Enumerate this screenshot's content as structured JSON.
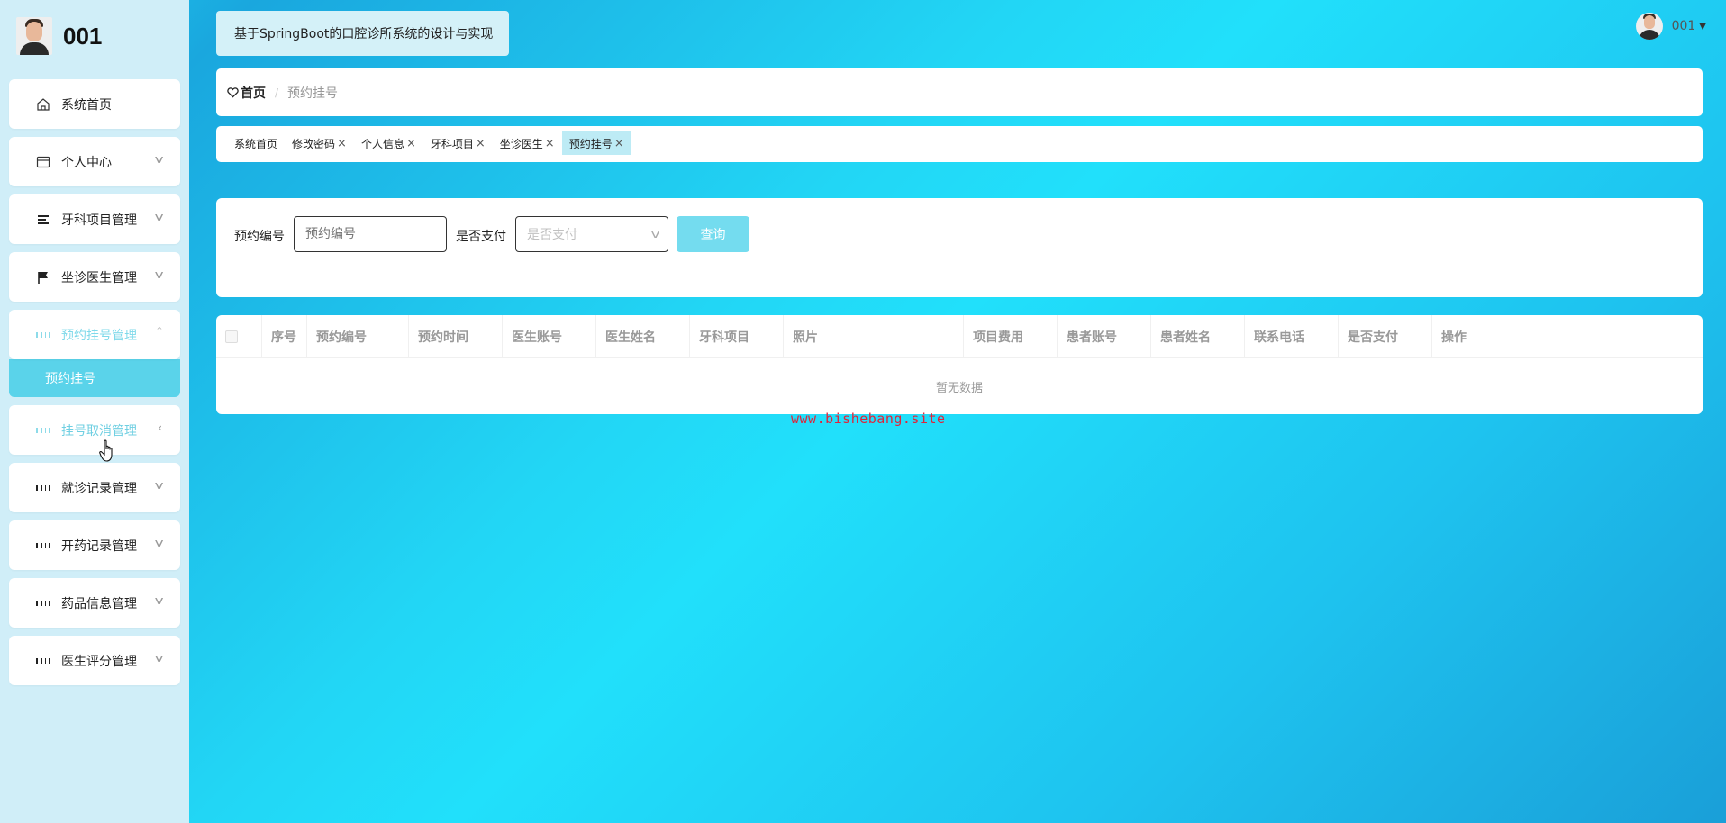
{
  "brand": {
    "title": "001"
  },
  "header": {
    "app_title": "基于SpringBoot的口腔诊所系统的设计与实现",
    "user_name": "001"
  },
  "sidebar": {
    "items": [
      {
        "label": "系统首页",
        "icon": "home-icon"
      },
      {
        "label": "个人中心",
        "icon": "card-icon"
      },
      {
        "label": "牙科项目管理",
        "icon": "list-icon"
      },
      {
        "label": "坐诊医生管理",
        "icon": "flag-icon"
      },
      {
        "label": "预约挂号管理",
        "icon": "grid-icon"
      },
      {
        "label": "挂号取消管理",
        "icon": "grid-icon"
      },
      {
        "label": "就诊记录管理",
        "icon": "grid-icon"
      },
      {
        "label": "开药记录管理",
        "icon": "grid-icon"
      },
      {
        "label": "药品信息管理",
        "icon": "grid-icon"
      },
      {
        "label": "医生评分管理",
        "icon": "grid-icon"
      }
    ],
    "sub_item": "预约挂号"
  },
  "breadcrumb": {
    "home": "首页",
    "separator": "/",
    "current": "预约挂号"
  },
  "tags": [
    {
      "label": "系统首页",
      "closable": false
    },
    {
      "label": "修改密码",
      "closable": true
    },
    {
      "label": "个人信息",
      "closable": true
    },
    {
      "label": "牙科项目",
      "closable": true
    },
    {
      "label": "坐诊医生",
      "closable": true
    },
    {
      "label": "预约挂号",
      "closable": true,
      "active": true
    }
  ],
  "search": {
    "field1_label": "预约编号",
    "field1_placeholder": "预约编号",
    "field2_label": "是否支付",
    "field2_placeholder": "是否支付",
    "query_button": "查询"
  },
  "table": {
    "columns": [
      "序号",
      "预约编号",
      "预约时间",
      "医生账号",
      "医生姓名",
      "牙科项目",
      "照片",
      "项目费用",
      "患者账号",
      "患者姓名",
      "联系电话",
      "是否支付",
      "操作"
    ],
    "empty_text": "暂无数据"
  },
  "watermark": "www.bishebang.site",
  "colors": {
    "accent": "#5ad3ea",
    "button": "#74dcef",
    "watermark": "#e0243a"
  }
}
